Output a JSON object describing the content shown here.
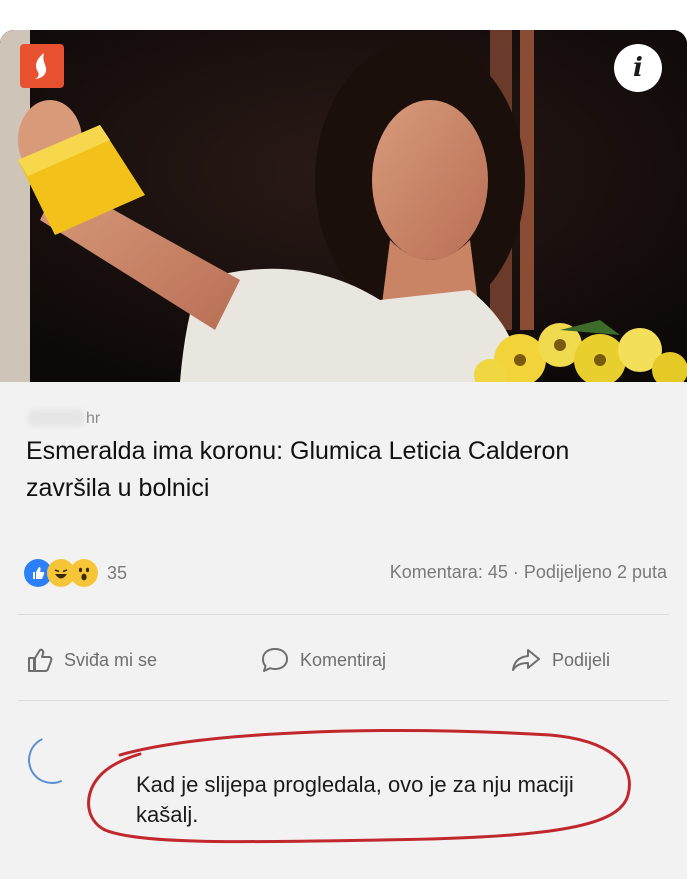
{
  "post": {
    "source": "hr",
    "headline": "Esmeralda ima koronu: Glumica Leticia Calderon završila u bolnici",
    "reaction_count": "35",
    "comments": "Komentara: 45",
    "separator": "·",
    "shares": "Podijeljeno 2 puta"
  },
  "actions": {
    "like": "Sviđa mi se",
    "comment": "Komentiraj",
    "share": "Podijeli"
  },
  "comment": {
    "text": "Kad je slijepa progledala, ovo je za nju maciji kašalj."
  },
  "icons": {
    "top_left": "app-logo-icon",
    "top_right": "info-icon",
    "reactions": [
      "like-icon",
      "haha-icon",
      "wow-icon"
    ]
  },
  "colors": {
    "like_blue": "#2d7ff9",
    "reaction_yellow": "#f7c538",
    "annotation_red": "#c0282d",
    "badge_orange": "#e8512f"
  }
}
